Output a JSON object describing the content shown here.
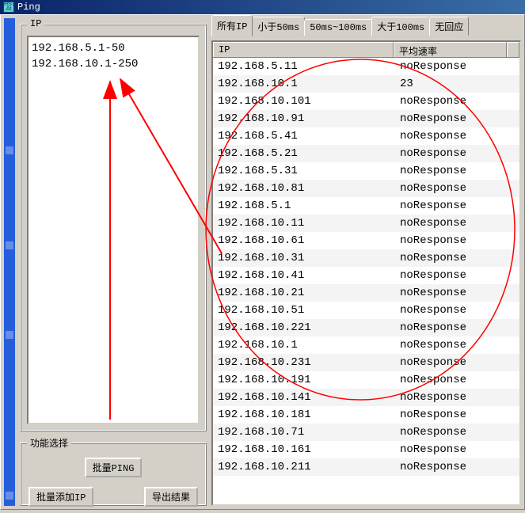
{
  "window": {
    "title": "Ping",
    "icon_label": "app-icon"
  },
  "left": {
    "ip_legend": "IP",
    "ip_ranges": "192.168.5.1-50\n192.168.10.1-250",
    "func_legend": "功能选择",
    "btn_batch_ping": "批量PING",
    "btn_batch_add": "批量添加IP",
    "btn_export": "导出结果"
  },
  "tabs": [
    {
      "label": "所有IP",
      "active": true
    },
    {
      "label": "小于50ms",
      "active": false
    },
    {
      "label": "50ms~100ms",
      "active": false
    },
    {
      "label": "大于100ms",
      "active": false
    },
    {
      "label": "无回应",
      "active": false
    }
  ],
  "table": {
    "headers": {
      "ip": "IP",
      "rate": "平均速率"
    },
    "rows": [
      {
        "ip": "192.168.5.11",
        "rate": "noResponse"
      },
      {
        "ip": "192.168.10.1",
        "rate": "23"
      },
      {
        "ip": "192.168.10.101",
        "rate": "noResponse"
      },
      {
        "ip": "192.168.10.91",
        "rate": "noResponse"
      },
      {
        "ip": "192.168.5.41",
        "rate": "noResponse"
      },
      {
        "ip": "192.168.5.21",
        "rate": "noResponse"
      },
      {
        "ip": "192.168.5.31",
        "rate": "noResponse"
      },
      {
        "ip": "192.168.10.81",
        "rate": "noResponse"
      },
      {
        "ip": "192.168.5.1",
        "rate": "noResponse"
      },
      {
        "ip": "192.168.10.11",
        "rate": "noResponse"
      },
      {
        "ip": "192.168.10.61",
        "rate": "noResponse"
      },
      {
        "ip": "192.168.10.31",
        "rate": "noResponse"
      },
      {
        "ip": "192.168.10.41",
        "rate": "noResponse"
      },
      {
        "ip": "192.168.10.21",
        "rate": "noResponse"
      },
      {
        "ip": "192.168.10.51",
        "rate": "noResponse"
      },
      {
        "ip": "192.168.10.221",
        "rate": "noResponse"
      },
      {
        "ip": "192.168.10.1",
        "rate": "noResponse"
      },
      {
        "ip": "192.168.10.231",
        "rate": "noResponse"
      },
      {
        "ip": "192.168.10.191",
        "rate": "noResponse"
      },
      {
        "ip": "192.168.10.141",
        "rate": "noResponse"
      },
      {
        "ip": "192.168.10.181",
        "rate": "noResponse"
      },
      {
        "ip": "192.168.10.71",
        "rate": "noResponse"
      },
      {
        "ip": "192.168.10.161",
        "rate": "noResponse"
      },
      {
        "ip": "192.168.10.211",
        "rate": "noResponse"
      }
    ]
  },
  "annot_color": "#ff0000"
}
